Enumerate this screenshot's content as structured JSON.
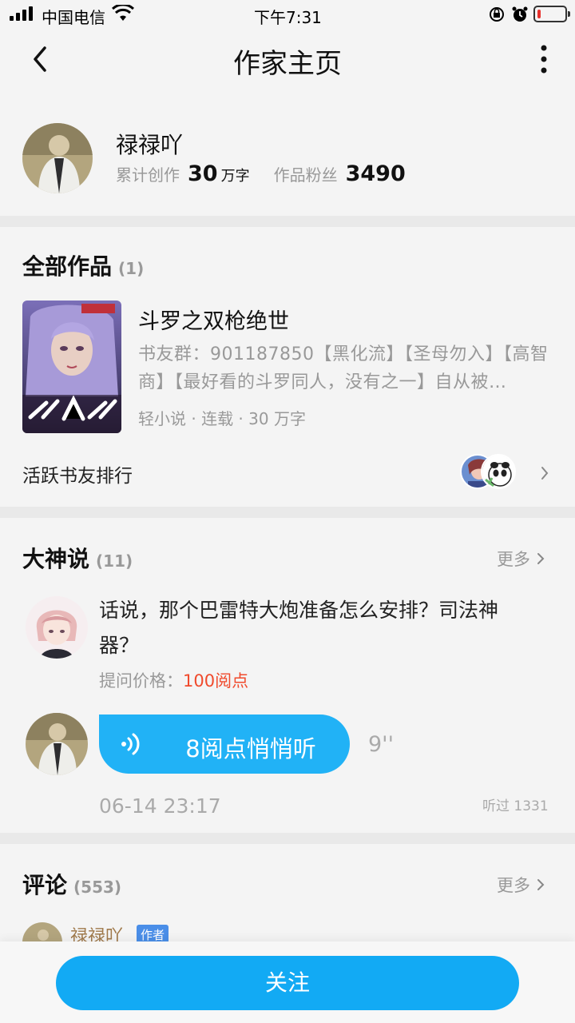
{
  "status_bar": {
    "carrier": "中国电信",
    "time": "下午7:31",
    "battery_level": 0.12,
    "icons": [
      "signal-icon",
      "wifi-icon",
      "rotation-lock-icon",
      "alarm-icon",
      "battery-icon"
    ]
  },
  "nav": {
    "title": "作家主页",
    "back_icon": "chevron-left-icon",
    "more_icon": "more-vertical-icon"
  },
  "profile": {
    "name": "禄禄吖",
    "total_label": "累计创作",
    "total_value": "30",
    "total_unit": "万字",
    "fans_label": "作品粉丝",
    "fans_value": "3490"
  },
  "works": {
    "title": "全部作品",
    "count": "(1)",
    "book": {
      "title": "斗罗之双枪绝世",
      "description": "书友群：901187850【黑化流】【圣母勿入】【高智商】【最好看的斗罗同人，没有之一】自从被…",
      "meta": "轻小说 · 连载 · 30 万字"
    },
    "fans_rank_label": "活跃书友排行"
  },
  "qa": {
    "title": "大神说",
    "count": "(11)",
    "more": "更多",
    "question": "话说，那个巴雷特大炮准备怎么安排？司法神器？",
    "price_label": "提问价格：",
    "price_value": "100阅点",
    "voice_label": "8阅点悄悄听",
    "duration": "9''",
    "time": "06-14 23:17",
    "listened": "听过 1331"
  },
  "comments": {
    "title": "评论",
    "count": "(553)",
    "more": "更多",
    "first_commenter": "禄禄吖",
    "author_tag": "作者"
  },
  "bottom": {
    "follow_label": "关注"
  },
  "colors": {
    "accent": "#12aaf4",
    "voice": "#21b2f6",
    "price": "#f04a2c",
    "tag": "#4a8ee8"
  }
}
